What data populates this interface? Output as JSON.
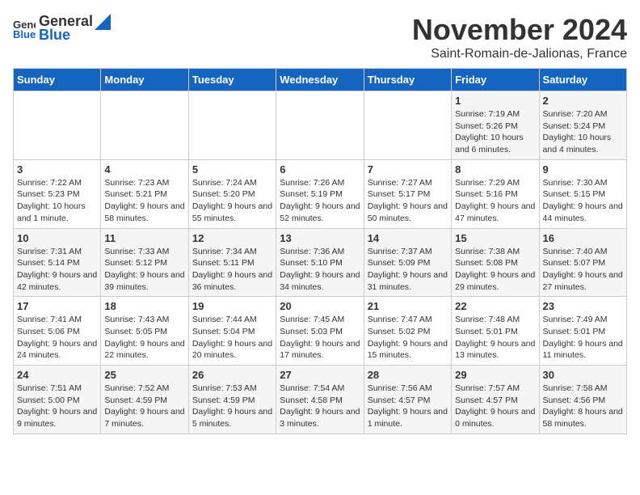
{
  "logo": {
    "general": "General",
    "blue": "Blue"
  },
  "title": "November 2024",
  "subtitle": "Saint-Romain-de-Jalionas, France",
  "days_of_week": [
    "Sunday",
    "Monday",
    "Tuesday",
    "Wednesday",
    "Thursday",
    "Friday",
    "Saturday"
  ],
  "weeks": [
    [
      {
        "day": "",
        "info": ""
      },
      {
        "day": "",
        "info": ""
      },
      {
        "day": "",
        "info": ""
      },
      {
        "day": "",
        "info": ""
      },
      {
        "day": "",
        "info": ""
      },
      {
        "day": "1",
        "info": "Sunrise: 7:19 AM\nSunset: 5:26 PM\nDaylight: 10 hours and 6 minutes."
      },
      {
        "day": "2",
        "info": "Sunrise: 7:20 AM\nSunset: 5:24 PM\nDaylight: 10 hours and 4 minutes."
      }
    ],
    [
      {
        "day": "3",
        "info": "Sunrise: 7:22 AM\nSunset: 5:23 PM\nDaylight: 10 hours and 1 minute."
      },
      {
        "day": "4",
        "info": "Sunrise: 7:23 AM\nSunset: 5:21 PM\nDaylight: 9 hours and 58 minutes."
      },
      {
        "day": "5",
        "info": "Sunrise: 7:24 AM\nSunset: 5:20 PM\nDaylight: 9 hours and 55 minutes."
      },
      {
        "day": "6",
        "info": "Sunrise: 7:26 AM\nSunset: 5:19 PM\nDaylight: 9 hours and 52 minutes."
      },
      {
        "day": "7",
        "info": "Sunrise: 7:27 AM\nSunset: 5:17 PM\nDaylight: 9 hours and 50 minutes."
      },
      {
        "day": "8",
        "info": "Sunrise: 7:29 AM\nSunset: 5:16 PM\nDaylight: 9 hours and 47 minutes."
      },
      {
        "day": "9",
        "info": "Sunrise: 7:30 AM\nSunset: 5:15 PM\nDaylight: 9 hours and 44 minutes."
      }
    ],
    [
      {
        "day": "10",
        "info": "Sunrise: 7:31 AM\nSunset: 5:14 PM\nDaylight: 9 hours and 42 minutes."
      },
      {
        "day": "11",
        "info": "Sunrise: 7:33 AM\nSunset: 5:12 PM\nDaylight: 9 hours and 39 minutes."
      },
      {
        "day": "12",
        "info": "Sunrise: 7:34 AM\nSunset: 5:11 PM\nDaylight: 9 hours and 36 minutes."
      },
      {
        "day": "13",
        "info": "Sunrise: 7:36 AM\nSunset: 5:10 PM\nDaylight: 9 hours and 34 minutes."
      },
      {
        "day": "14",
        "info": "Sunrise: 7:37 AM\nSunset: 5:09 PM\nDaylight: 9 hours and 31 minutes."
      },
      {
        "day": "15",
        "info": "Sunrise: 7:38 AM\nSunset: 5:08 PM\nDaylight: 9 hours and 29 minutes."
      },
      {
        "day": "16",
        "info": "Sunrise: 7:40 AM\nSunset: 5:07 PM\nDaylight: 9 hours and 27 minutes."
      }
    ],
    [
      {
        "day": "17",
        "info": "Sunrise: 7:41 AM\nSunset: 5:06 PM\nDaylight: 9 hours and 24 minutes."
      },
      {
        "day": "18",
        "info": "Sunrise: 7:43 AM\nSunset: 5:05 PM\nDaylight: 9 hours and 22 minutes."
      },
      {
        "day": "19",
        "info": "Sunrise: 7:44 AM\nSunset: 5:04 PM\nDaylight: 9 hours and 20 minutes."
      },
      {
        "day": "20",
        "info": "Sunrise: 7:45 AM\nSunset: 5:03 PM\nDaylight: 9 hours and 17 minutes."
      },
      {
        "day": "21",
        "info": "Sunrise: 7:47 AM\nSunset: 5:02 PM\nDaylight: 9 hours and 15 minutes."
      },
      {
        "day": "22",
        "info": "Sunrise: 7:48 AM\nSunset: 5:01 PM\nDaylight: 9 hours and 13 minutes."
      },
      {
        "day": "23",
        "info": "Sunrise: 7:49 AM\nSunset: 5:01 PM\nDaylight: 9 hours and 11 minutes."
      }
    ],
    [
      {
        "day": "24",
        "info": "Sunrise: 7:51 AM\nSunset: 5:00 PM\nDaylight: 9 hours and 9 minutes."
      },
      {
        "day": "25",
        "info": "Sunrise: 7:52 AM\nSunset: 4:59 PM\nDaylight: 9 hours and 7 minutes."
      },
      {
        "day": "26",
        "info": "Sunrise: 7:53 AM\nSunset: 4:59 PM\nDaylight: 9 hours and 5 minutes."
      },
      {
        "day": "27",
        "info": "Sunrise: 7:54 AM\nSunset: 4:58 PM\nDaylight: 9 hours and 3 minutes."
      },
      {
        "day": "28",
        "info": "Sunrise: 7:56 AM\nSunset: 4:57 PM\nDaylight: 9 hours and 1 minute."
      },
      {
        "day": "29",
        "info": "Sunrise: 7:57 AM\nSunset: 4:57 PM\nDaylight: 9 hours and 0 minutes."
      },
      {
        "day": "30",
        "info": "Sunrise: 7:58 AM\nSunset: 4:56 PM\nDaylight: 8 hours and 58 minutes."
      }
    ]
  ]
}
